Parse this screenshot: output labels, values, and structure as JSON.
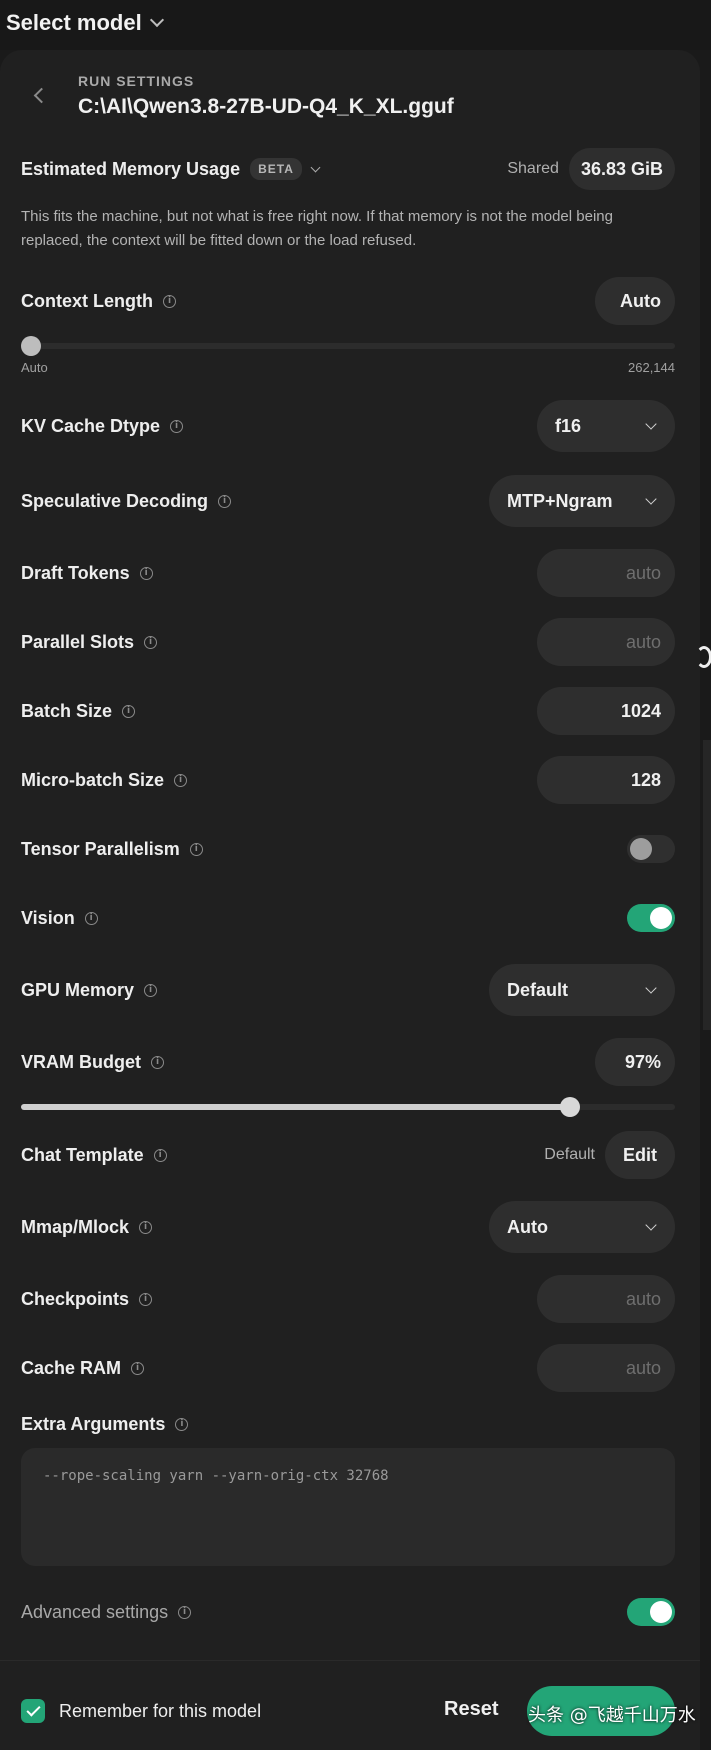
{
  "header": {
    "select_model": "Select model"
  },
  "panel": {
    "title": "RUN SETTINGS",
    "model_path": "C:\\AI\\Qwen3.8-27B-UD-Q4_K_XL.gguf"
  },
  "memory": {
    "label": "Estimated Memory Usage",
    "badge": "BETA",
    "shared_label": "Shared",
    "shared_value": "36.83 GiB",
    "description": "This fits the machine, but not what is free right now. If that memory is not the model being replaced, the context will be fitted down or the load refused."
  },
  "settings": {
    "context_length": {
      "label": "Context Length",
      "value": "Auto",
      "min_label": "Auto",
      "max_label": "262,144",
      "slider_fraction": 0.0
    },
    "kv_cache": {
      "label": "KV Cache Dtype",
      "value": "f16"
    },
    "speculative": {
      "label": "Speculative Decoding",
      "value": "MTP+Ngram"
    },
    "draft_tokens": {
      "label": "Draft Tokens",
      "placeholder": "auto"
    },
    "parallel_slots": {
      "label": "Parallel Slots",
      "placeholder": "auto"
    },
    "batch_size": {
      "label": "Batch Size",
      "value": "1024"
    },
    "micro_batch": {
      "label": "Micro-batch Size",
      "value": "128"
    },
    "tensor_parallelism": {
      "label": "Tensor Parallelism",
      "enabled": false
    },
    "vision": {
      "label": "Vision",
      "enabled": true
    },
    "gpu_memory": {
      "label": "GPU Memory",
      "value": "Default"
    },
    "vram_budget": {
      "label": "VRAM Budget",
      "value": "97%",
      "slider_fraction": 0.84
    },
    "chat_template": {
      "label": "Chat Template",
      "status": "Default",
      "edit_label": "Edit"
    },
    "mmap": {
      "label": "Mmap/Mlock",
      "value": "Auto"
    },
    "checkpoints": {
      "label": "Checkpoints",
      "placeholder": "auto"
    },
    "cache_ram": {
      "label": "Cache RAM",
      "placeholder": "auto"
    },
    "extra_args": {
      "label": "Extra Arguments",
      "value": "--rope-scaling yarn --yarn-orig-ctx 32768"
    },
    "advanced": {
      "label": "Advanced settings",
      "enabled": true
    }
  },
  "footer": {
    "remember_label": "Remember for this model",
    "remember_checked": true,
    "reset_label": "Reset",
    "watermark": "头条 @飞越千山万水"
  },
  "colors": {
    "accent": "#23a577",
    "panel": "#202020",
    "background": "#1a1a1a"
  }
}
